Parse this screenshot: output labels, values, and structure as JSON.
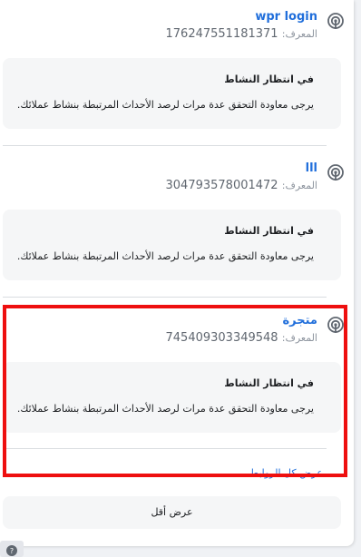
{
  "id_label": "المعرف:",
  "entries": [
    {
      "name": "wpr login",
      "id": "176247551181371",
      "status_title": "في انتظار النشاط",
      "status_description": "يرجى معاودة التحقق عدة مرات لرصد الأحداث المرتبطة بنشاط عملائك."
    },
    {
      "name": "ااا",
      "id": "304793578001472",
      "status_title": "في انتظار النشاط",
      "status_description": "يرجى معاودة التحقق عدة مرات لرصد الأحداث المرتبطة بنشاط عملائك."
    },
    {
      "name": "متجرة",
      "id": "745409303349548",
      "status_title": "في انتظار النشاط",
      "status_description": "يرجى معاودة التحقق عدة مرات لرصد الأحداث المرتبطة بنشاط عملائك."
    }
  ],
  "view_all_link": "عرض كل الروابط",
  "view_less_button": "عرض أقل",
  "icons": {
    "entry": "broadcast-icon",
    "help": "help-icon"
  },
  "colors": {
    "link": "#216fdb",
    "highlight_border": "#ee0f0f",
    "status_box": "#f5f6f7",
    "page_background": "#f0f2f5"
  }
}
